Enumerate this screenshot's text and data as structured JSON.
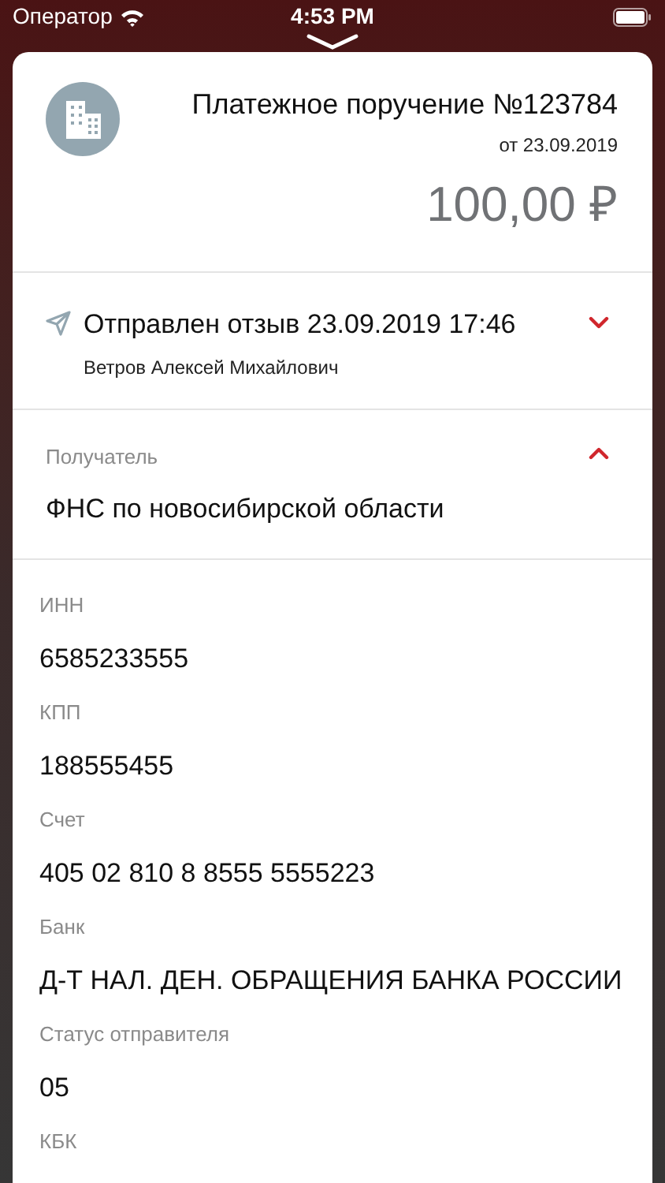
{
  "status_bar": {
    "carrier": "Оператор",
    "time": "4:53 PM"
  },
  "document": {
    "title": "Платежное поручение №123784",
    "date": "от 23.09.2019",
    "amount": "100,00 ₽"
  },
  "feedback": {
    "title": "Отправлен отзыв 23.09.2019 17:46",
    "author": "Ветров Алексей Михайлович",
    "expanded": false
  },
  "recipient": {
    "label": "Получатель",
    "name": "ФНС по новосибирской области",
    "expanded": true,
    "fields": [
      {
        "label": "ИНН",
        "value": "6585233555"
      },
      {
        "label": "КПП",
        "value": "188555455"
      },
      {
        "label": "Счет",
        "value": "405 02 810 8 8555 5555223"
      },
      {
        "label": "Банк",
        "value": "Д-Т НАЛ. ДЕН. ОБРАЩЕНИЯ БАНКА РОССИИ"
      },
      {
        "label": "Статус отправителя",
        "value": "05"
      },
      {
        "label": "КБК"
      }
    ]
  }
}
